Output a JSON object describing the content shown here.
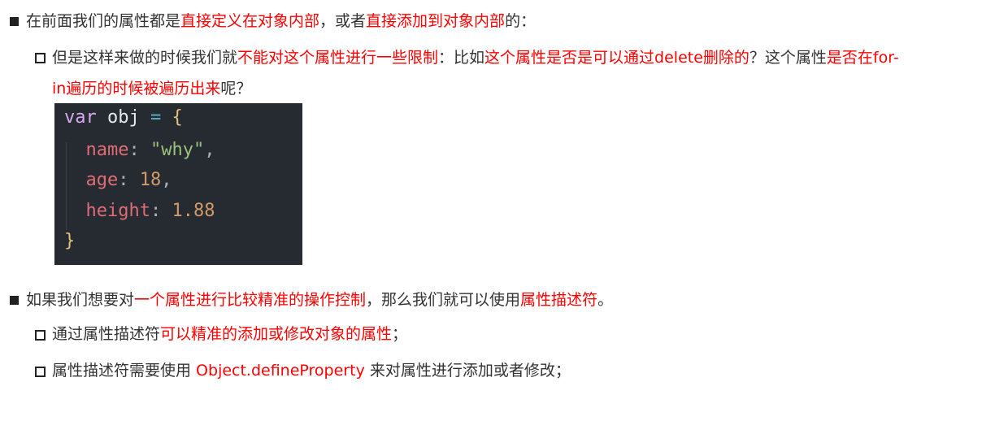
{
  "sections": [
    {
      "id": "s1",
      "segments": [
        {
          "text": "在前面我们的属性都是",
          "style": "dark"
        },
        {
          "text": "直接定义在对象内部",
          "style": "red"
        },
        {
          "text": "，或者",
          "style": "dark"
        },
        {
          "text": "直接添加到对象内部",
          "style": "red"
        },
        {
          "text": "的：",
          "style": "dark"
        }
      ]
    },
    {
      "id": "s1a",
      "line1": [
        {
          "text": "但是这样来做的时候我们就",
          "style": "dark"
        },
        {
          "text": "不能对这个属性进行一些限制",
          "style": "red"
        },
        {
          "text": "：比如",
          "style": "dark"
        },
        {
          "text": "这个属性是否是可以通过delete删除的",
          "style": "red"
        },
        {
          "text": "？这个属性",
          "style": "dark"
        },
        {
          "text": "是否在for-",
          "style": "red"
        }
      ],
      "line2": [
        {
          "text": "in遍历的时候被遍历出来",
          "style": "red"
        },
        {
          "text": "呢？",
          "style": "dark"
        }
      ]
    }
  ],
  "code": {
    "line1": {
      "kw": "var",
      "name": "obj",
      "op": "=",
      "brace": "{"
    },
    "line2": {
      "prop": "name",
      "colon": ":",
      "value": "\"why\"",
      "punct": ","
    },
    "line3": {
      "prop": "age",
      "colon": ":",
      "value": "18",
      "punct": ","
    },
    "line4": {
      "prop": "height",
      "colon": ":",
      "value": "1.88"
    },
    "line5": {
      "brace": "}"
    }
  },
  "section2": {
    "main": [
      {
        "text": "如果我们想要对",
        "style": "dark"
      },
      {
        "text": "一个属性进行比较精准的操作控制",
        "style": "red"
      },
      {
        "text": "，那么我们就可以使用",
        "style": "dark"
      },
      {
        "text": "属性描述符",
        "style": "red"
      },
      {
        "text": "。",
        "style": "dark"
      }
    ],
    "sub1": [
      {
        "text": "通过属性描述符",
        "style": "dark"
      },
      {
        "text": "可以精准的添加或修改对象的属性",
        "style": "red"
      },
      {
        "text": "；",
        "style": "dark"
      }
    ],
    "sub2": [
      {
        "text": "属性描述符需要使用 ",
        "style": "dark"
      },
      {
        "text": "Object.defineProperty",
        "style": "red"
      },
      {
        "text": " 来对属性进行添加或者修改；",
        "style": "dark"
      }
    ]
  }
}
